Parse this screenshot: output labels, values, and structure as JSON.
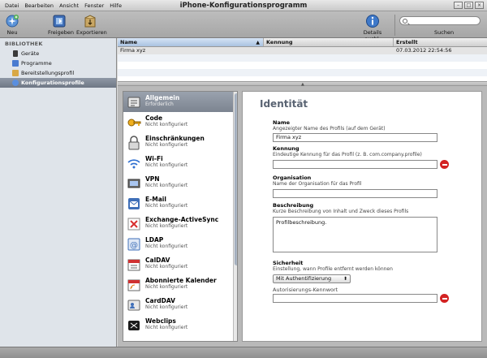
{
  "window": {
    "title": "iPhone-Konfigurationsprogramm",
    "menu": [
      "Datei",
      "Bearbeiten",
      "Ansicht",
      "Fenster",
      "Hilfe"
    ],
    "controls": [
      "–",
      "□",
      "×"
    ]
  },
  "toolbar": {
    "new_label": "Neu",
    "share_label": "Freigeben",
    "export_label": "Exportieren",
    "details_label": "Details ausbl.",
    "search_label": "Suchen",
    "search_value": ""
  },
  "sidebar": {
    "heading": "BIBLIOTHEK",
    "items": [
      {
        "label": "Geräte",
        "icon": "device-icon",
        "color": "#3a3a3a"
      },
      {
        "label": "Programme",
        "icon": "apps-icon",
        "color": "#4a7bd0"
      },
      {
        "label": "Bereitstellungsprofil",
        "icon": "provisioning-icon",
        "color": "#d9a845"
      },
      {
        "label": "Konfigurationsprofile",
        "icon": "config-profile-icon",
        "color": "#5a8fdf",
        "selected": true
      }
    ]
  },
  "table": {
    "columns": [
      "Name",
      "Kennung",
      "Erstellt"
    ],
    "rows": [
      {
        "name": "Firma xyz",
        "id": "",
        "created": "07.03.2012 22:54:56"
      }
    ]
  },
  "payloads": [
    {
      "title": "Allgemein",
      "status": "Erforderlich",
      "icon": "general-icon",
      "active": true
    },
    {
      "title": "Code",
      "status": "Nicht konfiguriert",
      "icon": "passcode-icon"
    },
    {
      "title": "Einschränkungen",
      "status": "Nicht konfiguriert",
      "icon": "restrictions-icon"
    },
    {
      "title": "Wi-Fi",
      "status": "Nicht konfiguriert",
      "icon": "wifi-icon"
    },
    {
      "title": "VPN",
      "status": "Nicht konfiguriert",
      "icon": "vpn-icon"
    },
    {
      "title": "E-Mail",
      "status": "Nicht konfiguriert",
      "icon": "email-icon"
    },
    {
      "title": "Exchange-ActiveSync",
      "status": "Nicht konfiguriert",
      "icon": "exchange-icon"
    },
    {
      "title": "LDAP",
      "status": "Nicht konfiguriert",
      "icon": "ldap-icon"
    },
    {
      "title": "CalDAV",
      "status": "Nicht konfiguriert",
      "icon": "caldav-icon"
    },
    {
      "title": "Abonnierte Kalender",
      "status": "Nicht konfiguriert",
      "icon": "subscribed-calendar-icon"
    },
    {
      "title": "CardDAV",
      "status": "Nicht konfiguriert",
      "icon": "carddav-icon"
    },
    {
      "title": "Webclips",
      "status": "Nicht konfiguriert",
      "icon": "webclips-icon"
    }
  ],
  "form": {
    "title": "Identität",
    "name_label": "Name",
    "name_desc": "Angezeigter Name des Profils (auf dem Gerät)",
    "name_value": "Firma xyz",
    "id_label": "Kennung",
    "id_desc": "Eindeutige Kennung für das Profil (z. B. com.company.profile)",
    "id_value": "",
    "org_label": "Organisation",
    "org_desc": "Name der Organisation für das Profil",
    "org_value": "",
    "desc_label": "Beschreibung",
    "desc_desc": "Kurze Beschreibung von Inhalt und Zweck dieses Profils",
    "desc_value": "Profilbeschreibung.",
    "security_label": "Sicherheit",
    "security_desc": "Einstellung, wann Profile entfernt werden können",
    "security_value": "Mit Authentifizierung",
    "auth_password_label": "Autorisierungs-Kennwort",
    "auth_password_value": "",
    "warning_color": "#d32222"
  }
}
